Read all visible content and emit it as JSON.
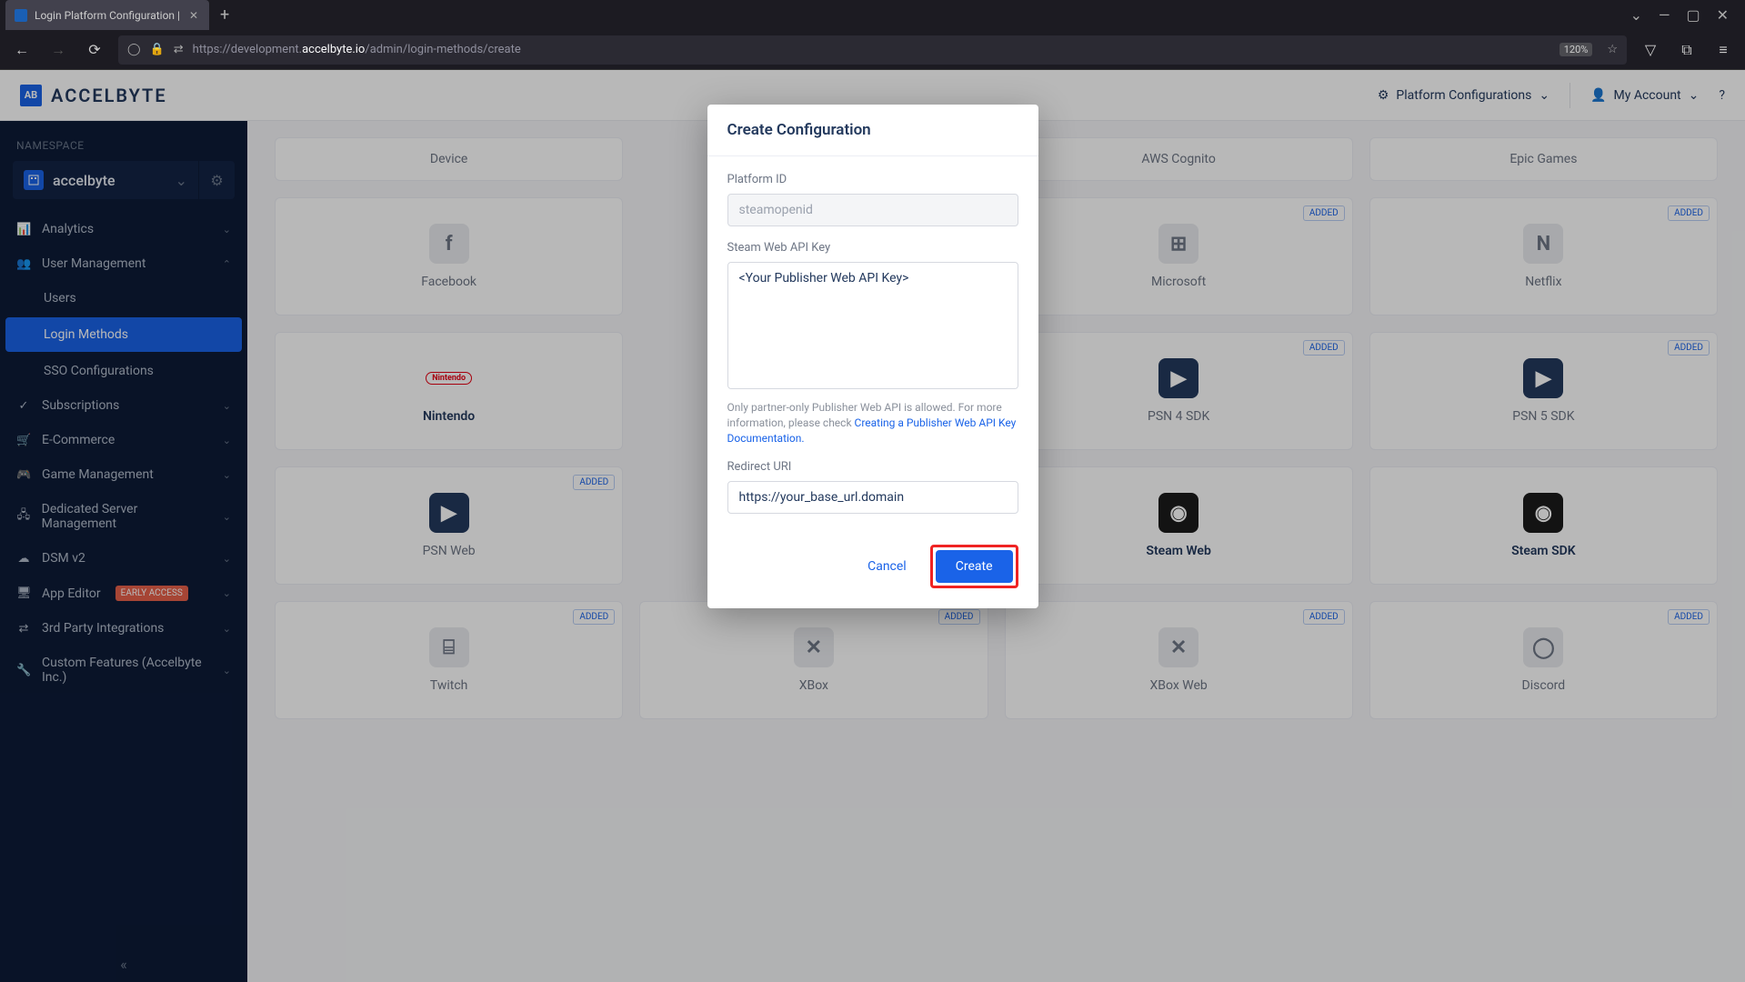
{
  "browser": {
    "tab_title": "Login Platform Configuration |",
    "url_prefix": "https://development.",
    "url_host": "accelbyte.io",
    "url_path": "/admin/login-methods/create",
    "zoom": "120%"
  },
  "header": {
    "brand": "ACCELBYTE",
    "brand_mark": "AB",
    "platform_config": "Platform Configurations",
    "my_account": "My Account"
  },
  "sidebar": {
    "namespace_label": "NAMESPACE",
    "namespace_value": "accelbyte",
    "items": [
      {
        "label": "Analytics",
        "expandable": true
      },
      {
        "label": "User Management",
        "expandable": true,
        "open": true
      },
      {
        "label": "Subscriptions",
        "expandable": true
      },
      {
        "label": "E-Commerce",
        "expandable": true
      },
      {
        "label": "Game Management",
        "expandable": true
      },
      {
        "label": "Dedicated Server Management",
        "expandable": true
      },
      {
        "label": "DSM v2",
        "expandable": true
      },
      {
        "label": "App Editor",
        "expandable": true,
        "badge": "EARLY ACCESS"
      },
      {
        "label": "3rd Party Integrations",
        "expandable": true
      },
      {
        "label": "Custom Features (Accelbyte Inc.)",
        "expandable": true
      }
    ],
    "user_mgmt_sub": [
      {
        "label": "Users"
      },
      {
        "label": "Login Methods",
        "active": true
      },
      {
        "label": "SSO Configurations"
      }
    ]
  },
  "grid": {
    "added_label": "ADDED",
    "rows": [
      [
        {
          "label": "Device"
        },
        {
          "label": ""
        },
        {
          "label": "AWS Cognito"
        },
        {
          "label": "Epic Games"
        }
      ],
      [
        {
          "label": "Facebook"
        },
        {
          "label": "",
          "added": true
        },
        {
          "label": "Microsoft",
          "added": true
        },
        {
          "label": "Netflix",
          "added": true
        }
      ],
      [
        {
          "label": "Nintendo"
        },
        {
          "label": ""
        },
        {
          "label": "PSN 4 SDK",
          "added": true,
          "dark": true
        },
        {
          "label": "PSN 5 SDK",
          "added": true,
          "dark": true
        }
      ],
      [
        {
          "label": "PSN Web",
          "added": true,
          "dark": true
        },
        {
          "label": ""
        },
        {
          "label": "Steam Web",
          "black": true
        },
        {
          "label": "Steam SDK",
          "black": true
        }
      ],
      [
        {
          "label": "Twitch",
          "added": true
        },
        {
          "label": "XBox",
          "added": true
        },
        {
          "label": "XBox Web",
          "added": true
        },
        {
          "label": "Discord",
          "added": true
        }
      ]
    ]
  },
  "modal": {
    "title": "Create Configuration",
    "platform_id_label": "Platform ID",
    "platform_id_value": "steamopenid",
    "api_key_label": "Steam Web API Key",
    "api_key_value": "<Your Publisher Web API Key>",
    "helper_prefix": "Only partner-only Publisher Web API is allowed. For more information, please check ",
    "helper_link": "Creating a Publisher Web API Key Documentation.",
    "redirect_label": "Redirect URI",
    "redirect_value": "https://your_base_url.domain",
    "cancel": "Cancel",
    "create": "Create"
  }
}
